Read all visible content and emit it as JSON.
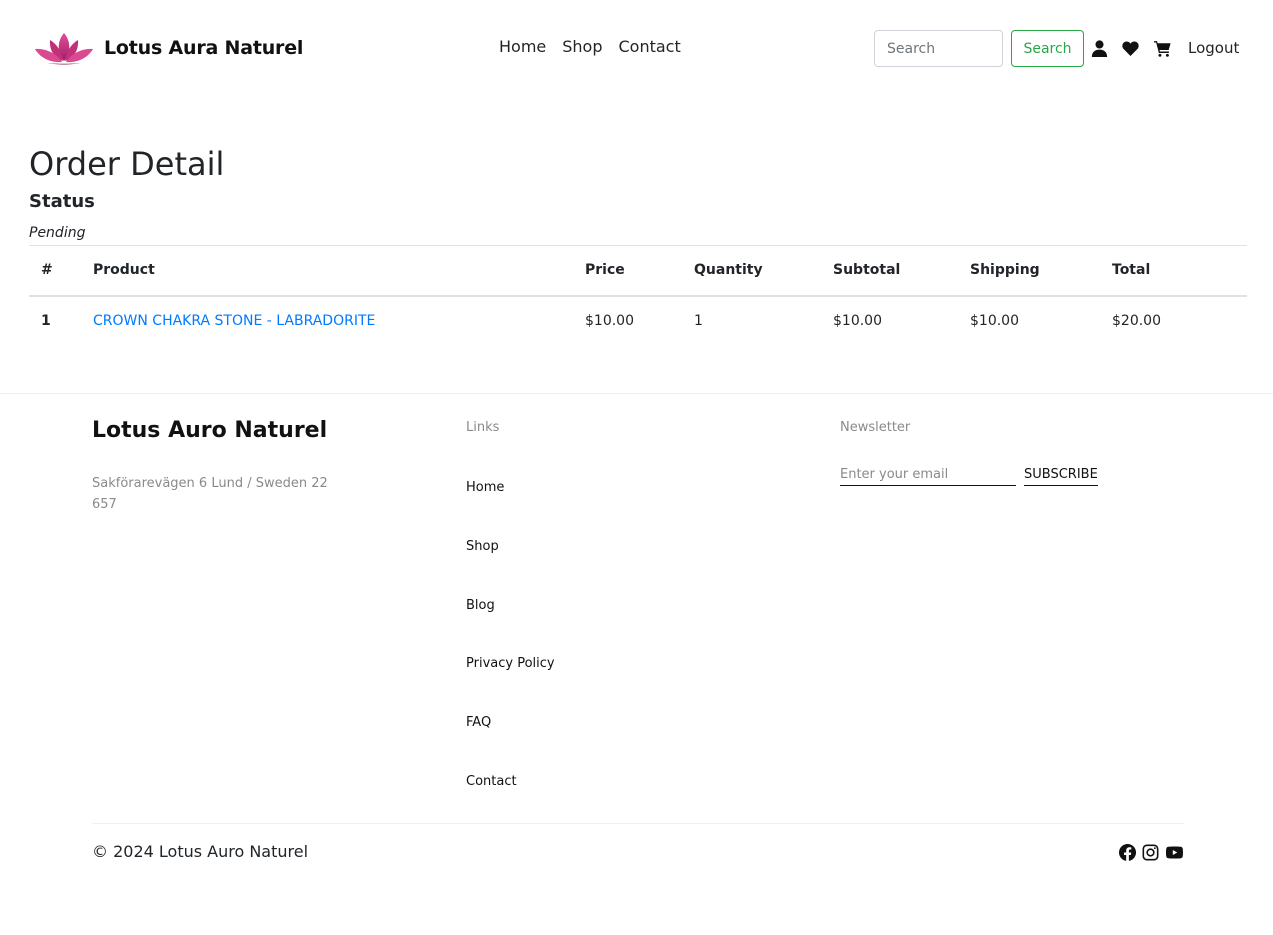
{
  "header": {
    "brand_name": "Lotus Aura Naturel",
    "nav": [
      "Home",
      "Shop",
      "Contact"
    ],
    "search_placeholder": "Search",
    "search_button": "Search",
    "logout_label": "Logout",
    "icons": [
      "user-icon",
      "heart-icon",
      "cart-icon"
    ]
  },
  "order": {
    "title": "Order Detail",
    "status_label": "Status",
    "status_value": "Pending",
    "columns": [
      "#",
      "Product",
      "Price",
      "Quantity",
      "Subtotal",
      "Shipping",
      "Total"
    ],
    "rows": [
      {
        "index": "1",
        "product": "CROWN CHAKRA STONE - LABRADORITE",
        "price": "$10.00",
        "quantity": "1",
        "subtotal": "$10.00",
        "shipping": "$10.00",
        "total": "$20.00"
      }
    ]
  },
  "footer": {
    "brand_name": "Lotus Auro Naturel",
    "address": "Sakförarevägen 6 Lund / Sweden 22 657",
    "links_title": "Links",
    "links": [
      "Home",
      "Shop",
      "Blog",
      "Privacy Policy",
      "FAQ",
      "Contact"
    ],
    "newsletter_title": "Newsletter",
    "email_placeholder": "Enter your email",
    "subscribe_label": "SUBSCRIBE",
    "copyright": "© 2024 Lotus Auro Naturel",
    "social_icons": [
      "facebook-icon",
      "instagram-icon",
      "youtube-icon"
    ]
  },
  "colors": {
    "accent_green": "#28a745",
    "link_blue": "#007bff",
    "lotus_pink": "#d63384",
    "muted_text": "#8a8a8a"
  }
}
